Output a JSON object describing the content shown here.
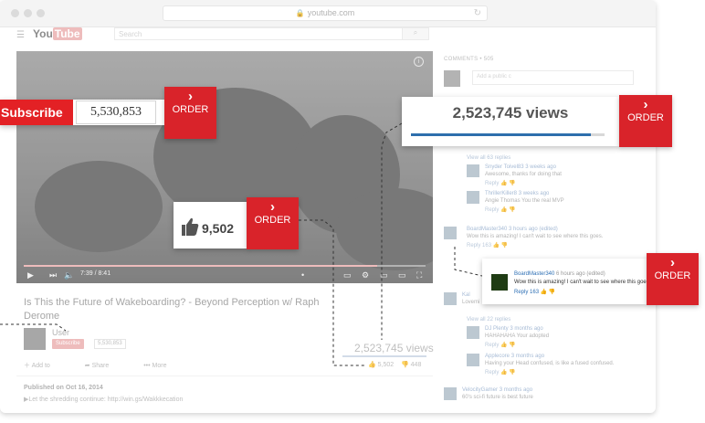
{
  "browser": {
    "url": "youtube.com"
  },
  "youtube": {
    "logo_you": "You",
    "logo_tube": "Tube",
    "search_placeholder": "Search",
    "video": {
      "time": "7:39 / 8:41",
      "progress_fraction": 0.88
    },
    "title": "Is This the Future of Wakeboarding? - Beyond Perception w/ Raph Derome",
    "channel": {
      "name": "User",
      "subscribe": "Subscribe",
      "count": "5,530,853"
    },
    "views": "2,523,745 views",
    "actions": {
      "add": "Add to",
      "share": "Share",
      "more": "More"
    },
    "likes": "5,502",
    "dislikes": "448",
    "published": "Published on Oct 16, 2014",
    "description": "Let the shredding continue: http://win.gs/Wakkkecation"
  },
  "comments": {
    "header": "COMMENTS • 505",
    "add_placeholder": "Add a public c",
    "view_all_1": "View all 63 replies",
    "view_all_2": "View all 22 replies",
    "items": [
      {
        "name": "Snyder Toivel83",
        "when": "3 weeks ago",
        "text": "Awesome, thanks for doing that"
      },
      {
        "name": "ThrillerKiller8",
        "when": "3 weeks ago",
        "text": "Angie Thomas You the real MVP"
      },
      {
        "name": "BoardMaster340",
        "when": "3 hours ago (edited)",
        "text": "Wow this is amazing! I can't wait to see where this goes."
      },
      {
        "name": "Kal",
        "when": "",
        "text": "Lovemi"
      },
      {
        "name": "DJ Plenty",
        "when": "3 months ago",
        "text": "HAHAHAHA Your adopted"
      },
      {
        "name": "Applecore",
        "when": "3 months ago",
        "text": "Having your Head confused, is like a fused confused."
      },
      {
        "name": "VelocityGamer",
        "when": "3 months ago",
        "text": "60's sci-fi future is best future"
      }
    ],
    "reply_label": "Reply",
    "reply_count": "163"
  },
  "widgets": {
    "order_label": "ORDER",
    "subscribe": {
      "label": "Subscribe",
      "count": "5,530,853"
    },
    "views": {
      "count": "2,523,745 views",
      "fill_fraction": 0.93
    },
    "likes": {
      "count": "9,502"
    },
    "comment_card": {
      "name": "BoardMaster340",
      "when": "6 hours ago (edited)",
      "text": "Wow this is amazing! I can't wait to see where this goes.",
      "reply": "Reply",
      "count": "163"
    }
  },
  "colors": {
    "order_red": "#d9232a",
    "subscribe_red": "#e32125",
    "views_blue": "#2e6fad"
  }
}
